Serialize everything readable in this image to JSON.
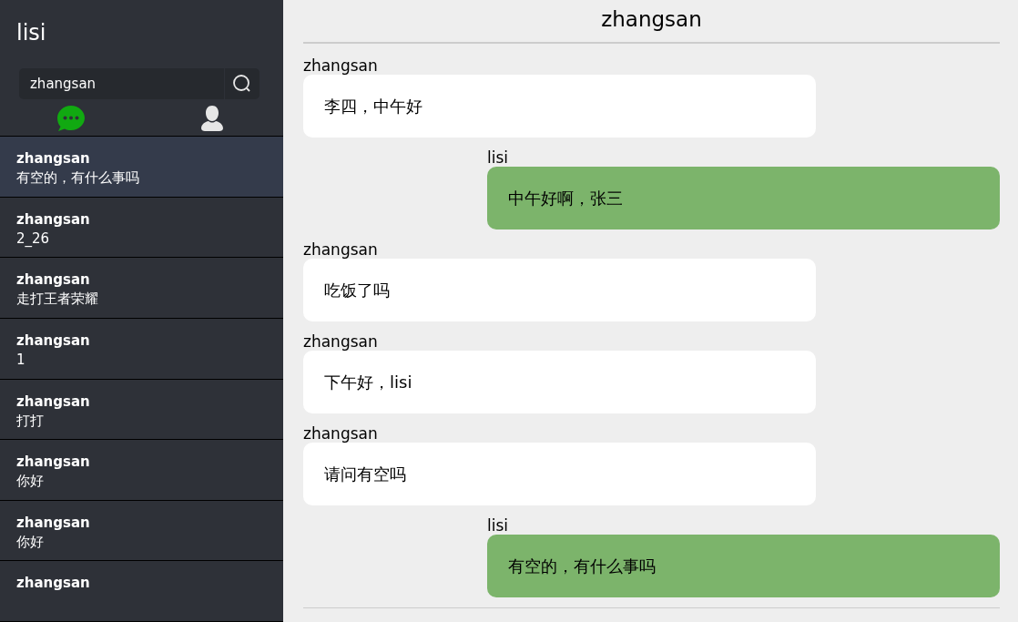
{
  "user": {
    "name": "lisi"
  },
  "search": {
    "value": "zhangsan"
  },
  "tabs": [
    {
      "kind": "chat",
      "selected": true
    },
    {
      "kind": "contacts",
      "selected": false
    }
  ],
  "conversations": [
    {
      "name": "zhangsan",
      "preview": "有空的，有什么事吗",
      "selected": true
    },
    {
      "name": "zhangsan",
      "preview": "2_26",
      "selected": false
    },
    {
      "name": "zhangsan",
      "preview": "走打王者荣耀",
      "selected": false
    },
    {
      "name": "zhangsan",
      "preview": "1",
      "selected": false
    },
    {
      "name": "zhangsan",
      "preview": "打打",
      "selected": false
    },
    {
      "name": "zhangsan",
      "preview": "你好",
      "selected": false
    },
    {
      "name": "zhangsan",
      "preview": "你好",
      "selected": false
    },
    {
      "name": "zhangsan",
      "selected": false
    }
  ],
  "chat": {
    "title": "zhangsan",
    "messages": [
      {
        "sender": "zhangsan",
        "text": "李四，中午好",
        "mine": false
      },
      {
        "sender": "lisi",
        "text": "中午好啊，张三",
        "mine": true
      },
      {
        "sender": "zhangsan",
        "text": "吃饭了吗",
        "mine": false
      },
      {
        "sender": "zhangsan",
        "text": "下午好，lisi",
        "mine": false
      },
      {
        "sender": "zhangsan",
        "text": "请问有空吗",
        "mine": false
      },
      {
        "sender": "lisi",
        "text": "有空的，有什么事吗",
        "mine": true
      }
    ]
  }
}
